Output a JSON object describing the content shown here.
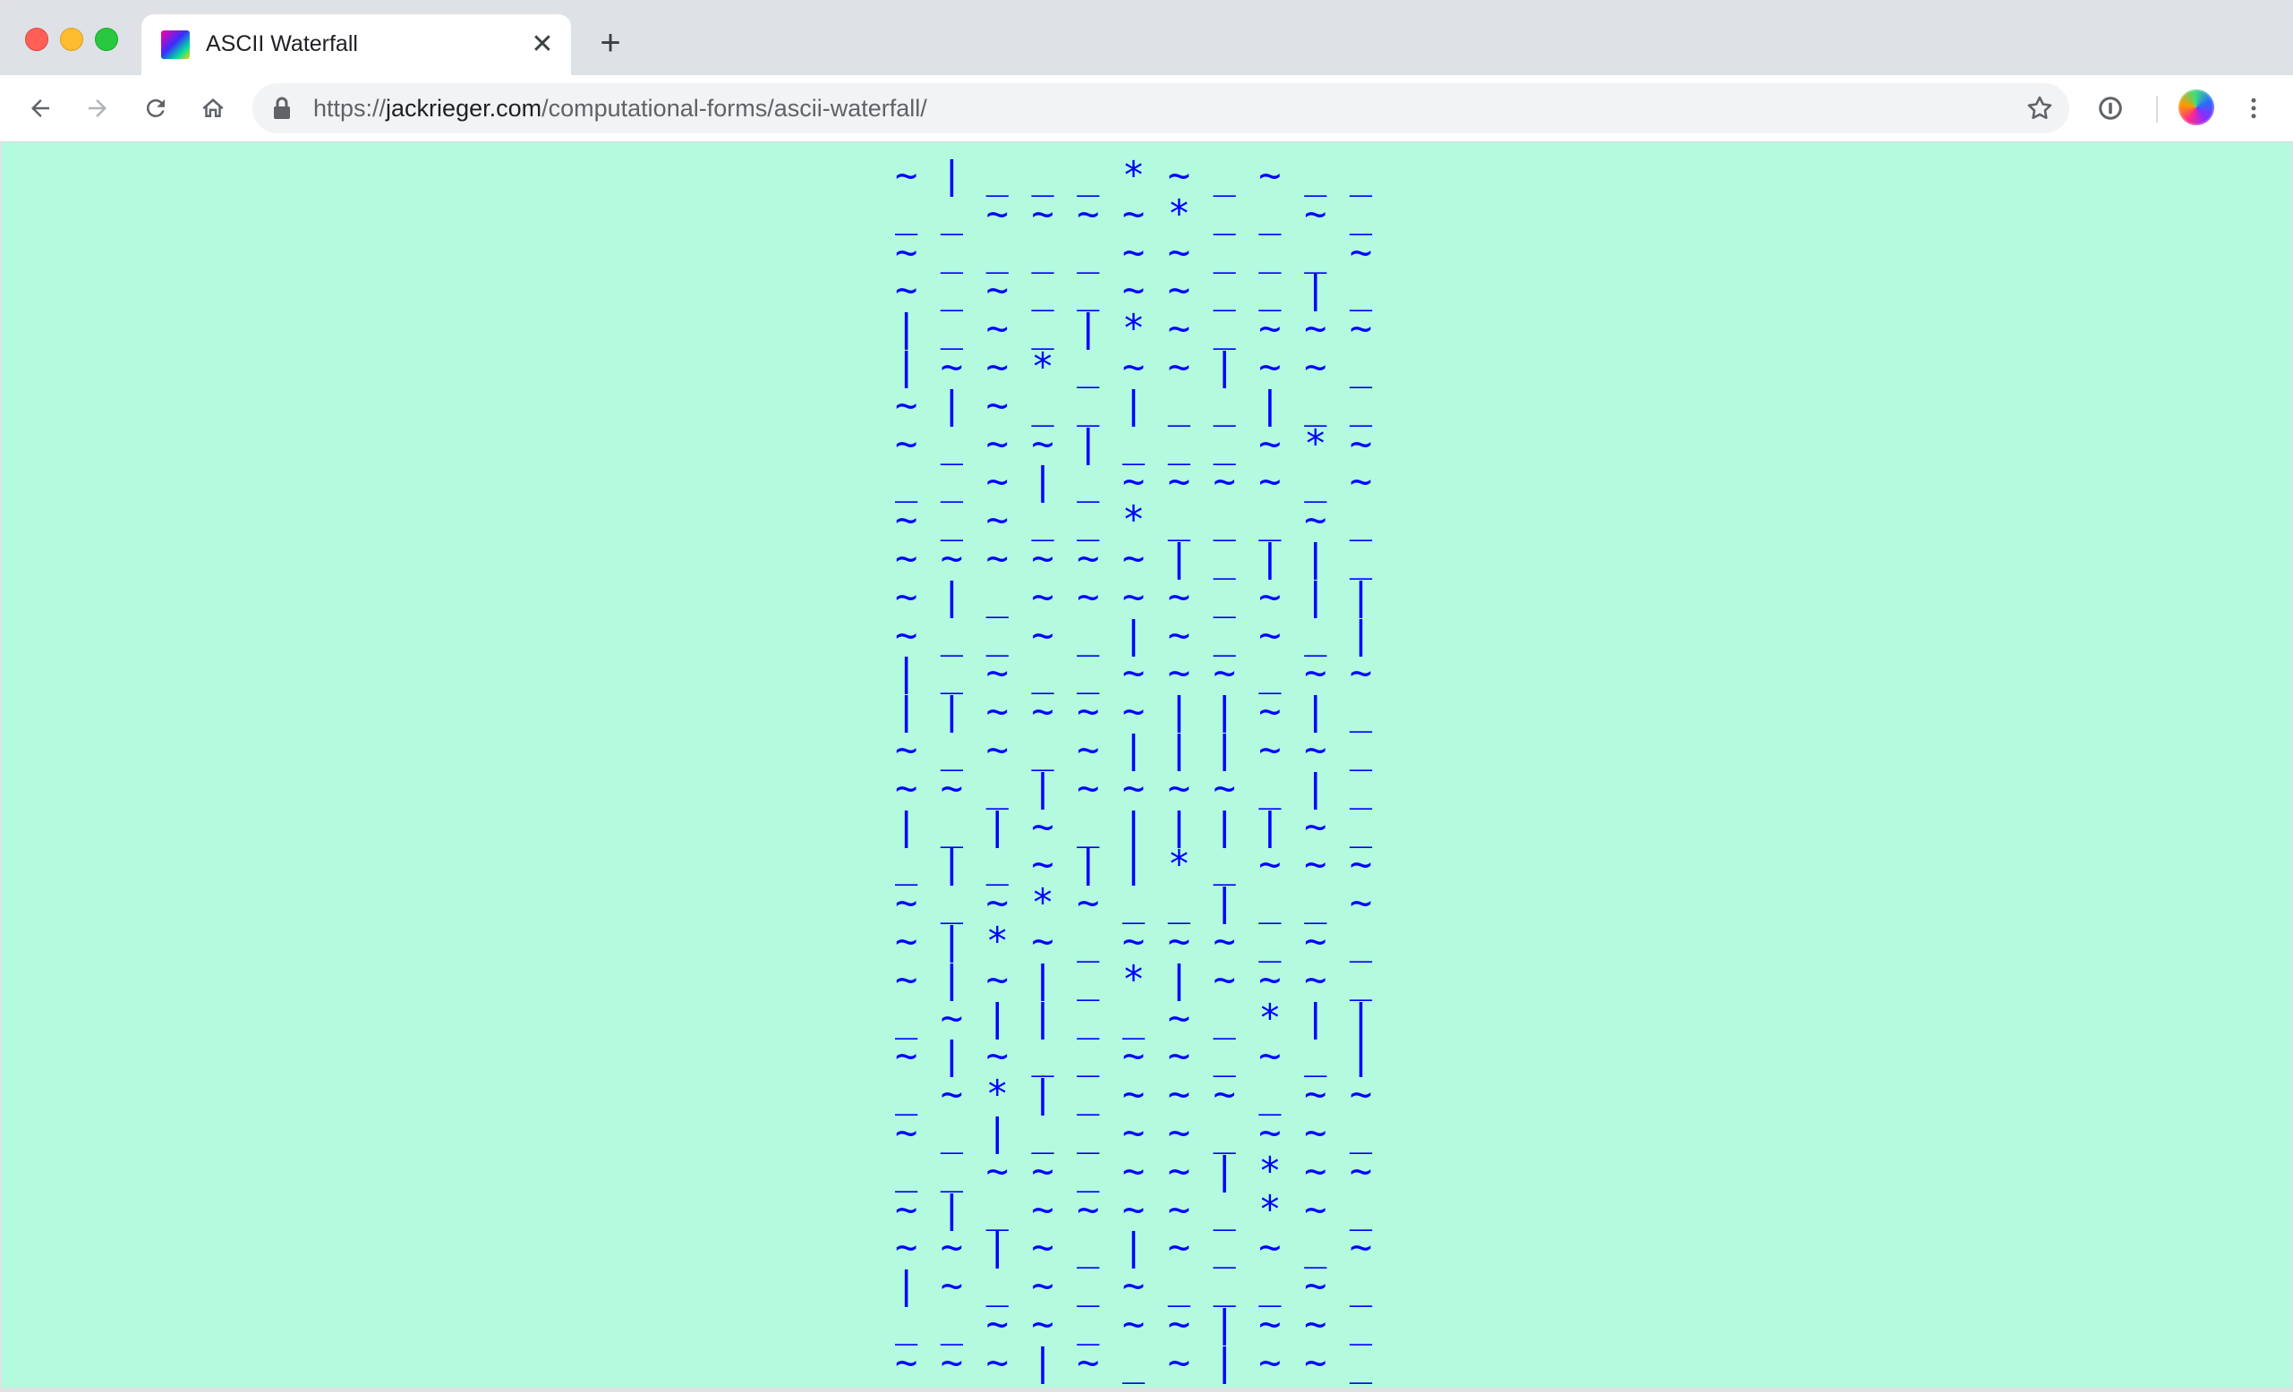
{
  "browser": {
    "tab": {
      "title": "ASCII Waterfall",
      "close_glyph": "✕",
      "favicon": "gradient-favicon-icon"
    },
    "new_tab_glyph": "+",
    "address_bar": {
      "scheme": "https://",
      "host": "jackrieger.com",
      "path": "/computational-forms/ascii-waterfall/"
    }
  },
  "page": {
    "background_color": "#b3fadf",
    "text_color": "#0000ff",
    "rows": [
      "~|___*~_~__",
      "__~~~~*__~_",
      "~____~~___~",
      "~_~__~~__|_",
      "|_~_|*~_~~~",
      "|~~*_~~|~~_",
      "~|~__|__|__",
      "~_~~|___~*~",
      "__~|_~~~~_~",
      "~_~__*___~_",
      "~~~~~~|_||_",
      "~|_~~~~_~||",
      "~__~_|~_~_|",
      "|_~__~~~_~~",
      "||~~~~||~|_",
      "~_~_~|||~~_",
      "~~_|~~~~_|_",
      "|_|~_||||~_",
      "_|_~||*_~~~",
      "~_~*~__|__~",
      "~|*~_~~~_~_",
      "~|~|_*|~~~_",
      "_~||__~_*||",
      "~|~__~~_~_|",
      "_~*|_~~~_~~",
      "~_|__~~_~~_",
      "__~~_~~|*~~",
      "~|_~~~~_*~_",
      "~~|~_|~_~_~",
      "|~_~_~___~_",
      "__~~_~~|~~_",
      "~~~|~_~|~~_"
    ]
  }
}
